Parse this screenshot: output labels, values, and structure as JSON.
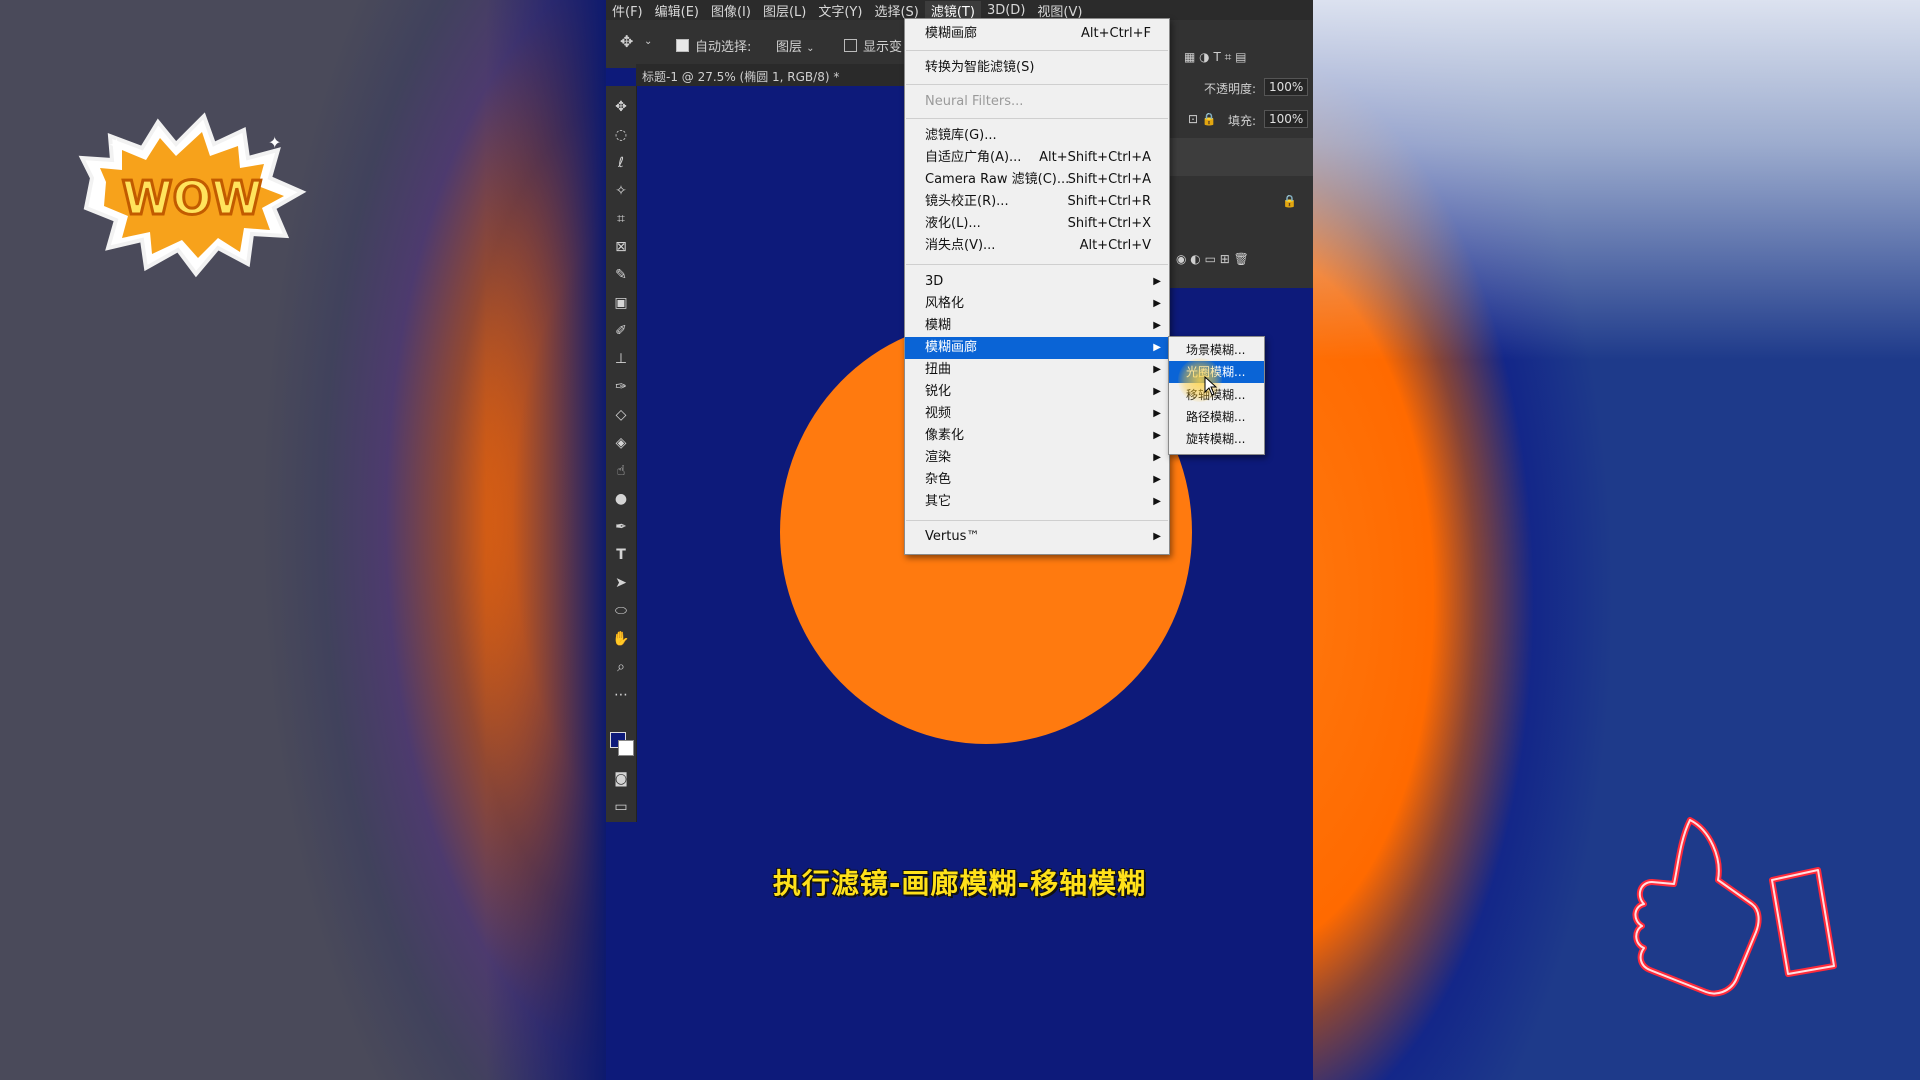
{
  "menubar": {
    "items": [
      {
        "label": "件(F)"
      },
      {
        "label": "编辑(E)"
      },
      {
        "label": "图像(I)"
      },
      {
        "label": "图层(L)"
      },
      {
        "label": "文字(Y)"
      },
      {
        "label": "选择(S)"
      },
      {
        "label": "滤镜(T)"
      },
      {
        "label": "3D(D)"
      },
      {
        "label": "视图(V)"
      }
    ]
  },
  "options": {
    "auto_select_label": "自动选择:",
    "layer_select_value": "图层",
    "show_transform_label": "显示变"
  },
  "document_tab": {
    "title": "标题-1 @ 27.5% (椭圆 1, RGB/8) *"
  },
  "layers_panel": {
    "opacity_label": "不透明度:",
    "opacity_value": "100%",
    "fill_label": "填充:",
    "fill_value": "100%"
  },
  "filter_menu": {
    "last_filter": {
      "label": "模糊画廊",
      "shortcut": "Alt+Ctrl+F"
    },
    "smart_filter": {
      "label": "转换为智能滤镜(S)"
    },
    "neural_filters": {
      "label": "Neural Filters..."
    },
    "filter_gallery": {
      "label": "滤镜库(G)..."
    },
    "adaptive_wide_angle": {
      "label": "自适应广角(A)...",
      "shortcut": "Alt+Shift+Ctrl+A"
    },
    "camera_raw": {
      "label": "Camera Raw 滤镜(C)...",
      "shortcut": "Shift+Ctrl+A"
    },
    "lens_correction": {
      "label": "镜头校正(R)...",
      "shortcut": "Shift+Ctrl+R"
    },
    "liquify": {
      "label": "液化(L)...",
      "shortcut": "Shift+Ctrl+X"
    },
    "vanishing_point": {
      "label": "消失点(V)...",
      "shortcut": "Alt+Ctrl+V"
    },
    "sub_3d": {
      "label": "3D"
    },
    "stylize": {
      "label": "风格化"
    },
    "blur": {
      "label": "模糊"
    },
    "blur_gallery": {
      "label": "模糊画廊"
    },
    "distort": {
      "label": "扭曲"
    },
    "sharpen": {
      "label": "锐化"
    },
    "video": {
      "label": "视频"
    },
    "pixelate": {
      "label": "像素化"
    },
    "render": {
      "label": "渲染"
    },
    "noise": {
      "label": "杂色"
    },
    "other": {
      "label": "其它"
    },
    "vertus": {
      "label": "Vertus™"
    }
  },
  "blur_gallery_submenu": {
    "field_blur": "场景模糊...",
    "iris_blur": "光圈模糊...",
    "tilt_shift": "移轴模糊...",
    "path_blur": "路径模糊...",
    "spin_blur": "旋转模糊..."
  },
  "caption": {
    "text": "执行滤镜-画廊模糊-移轴模糊"
  },
  "stickers": {
    "wow_text": "WOW"
  },
  "colors": {
    "canvas": "#0d1a7a",
    "circle": "#ff7a0f",
    "menu_highlight": "#0a64d6",
    "caption": "#ffe11a"
  }
}
